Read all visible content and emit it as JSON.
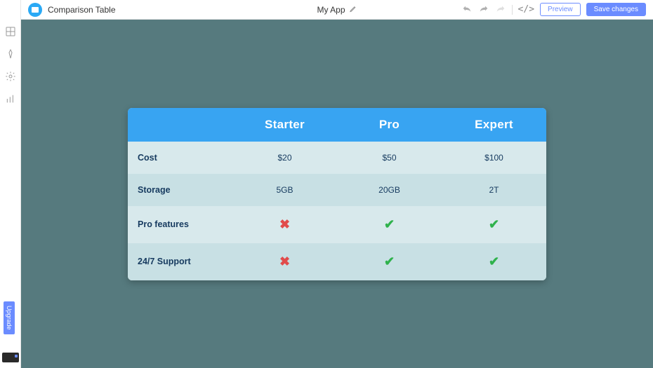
{
  "topbar": {
    "widget_title": "Comparison Table",
    "app_title": "My App",
    "preview_label": "Preview",
    "save_label": "Save changes",
    "code_label": "</>"
  },
  "sidebar": {
    "upgrade_label": "Upgrade"
  },
  "table": {
    "headers": {
      "blank": "",
      "col1": "Starter",
      "col2": "Pro",
      "col3": "Expert"
    },
    "rows": [
      {
        "label": "Cost",
        "values": [
          "$20",
          "$50",
          "$100"
        ],
        "type": "text"
      },
      {
        "label": "Storage",
        "values": [
          "5GB",
          "20GB",
          "2T"
        ],
        "type": "text"
      },
      {
        "label": "Pro features",
        "values": [
          false,
          true,
          true
        ],
        "type": "bool"
      },
      {
        "label": "24/7 Support",
        "values": [
          false,
          true,
          true
        ],
        "type": "bool"
      }
    ]
  },
  "colors": {
    "accent": "#38a4f2",
    "button": "#6b8cff",
    "canvas": "#567a7e",
    "check": "#2fb24c",
    "cross": "#e14b4b"
  }
}
